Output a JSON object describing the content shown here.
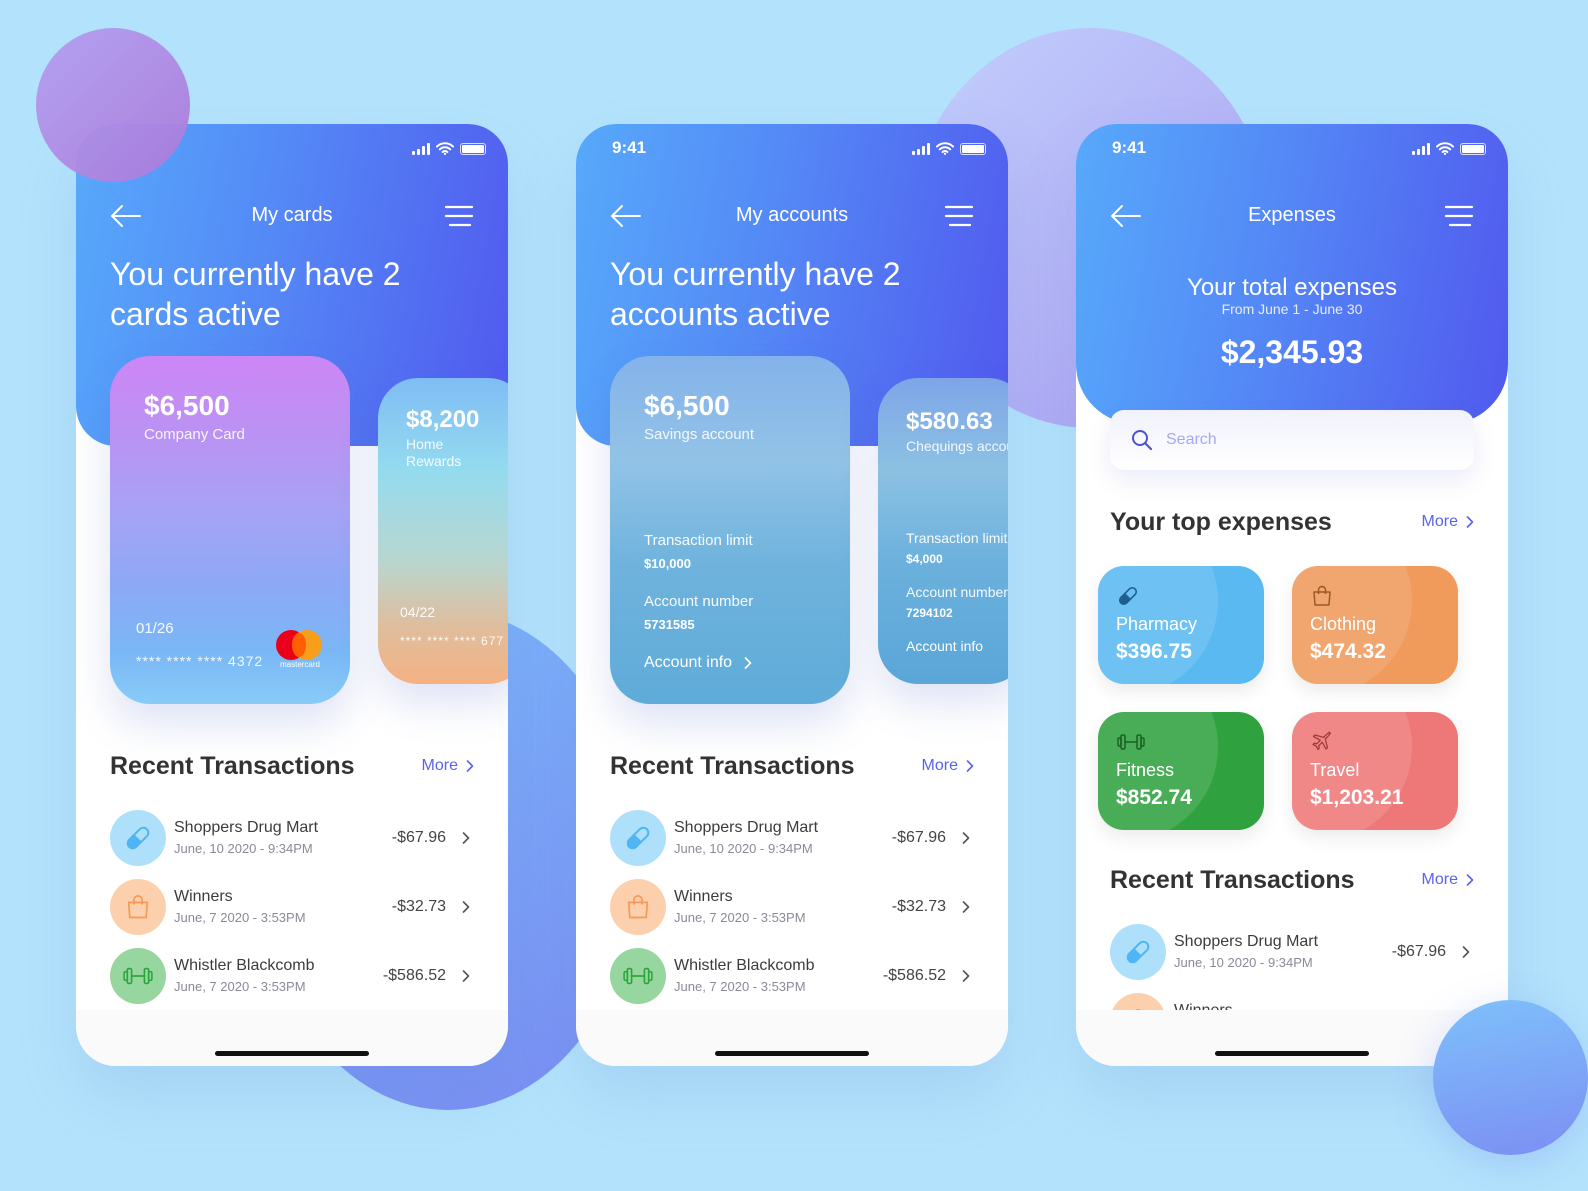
{
  "colors": {
    "background": "#b3e3fc",
    "header_gradient_start": "#57a9fb",
    "header_gradient_end": "#5159ee",
    "accent_link": "#5a63ec",
    "pharmacy": "#5bb9f2",
    "clothing": "#f09a5c",
    "fitness": "#2fa23f",
    "travel": "#ee7878"
  },
  "status_bar": {
    "time": "9:41"
  },
  "phone_cards": {
    "title": "My cards",
    "headline": "You currently have 2 cards active",
    "cards": [
      {
        "amount": "$6,500",
        "name": "Company Card",
        "expiry": "01/26",
        "number": "**** **** **** 4372",
        "brand": "mastercard"
      },
      {
        "amount": "$8,200",
        "name_line1": "Home",
        "name_line2": "Rewards",
        "expiry": "04/22",
        "number": "**** **** **** 677"
      }
    ]
  },
  "phone_accounts": {
    "title": "My accounts",
    "headline": "You currently have 2 accounts active",
    "accounts": [
      {
        "amount": "$6,500",
        "name": "Savings account",
        "limit_label": "Transaction limit",
        "limit": "$10,000",
        "number_label": "Account number",
        "number": "5731585",
        "info_label": "Account info"
      },
      {
        "amount": "$580.63",
        "name": "Chequings account",
        "limit_label": "Transaction limit",
        "limit": "$4,000",
        "number_label": "Account number",
        "number": "7294102",
        "info_label": "Account info"
      }
    ]
  },
  "phone_expenses": {
    "title": "Expenses",
    "total_label": "Your total expenses",
    "range": "From June 1 - June 30",
    "total": "$2,345.93",
    "search_placeholder": "Search",
    "top_expenses_heading": "Your top expenses",
    "categories": [
      {
        "name": "Pharmacy",
        "amount": "$396.75",
        "icon": "pill-icon"
      },
      {
        "name": "Clothing",
        "amount": "$474.32",
        "icon": "shopping-bag-icon"
      },
      {
        "name": "Fitness",
        "amount": "$852.74",
        "icon": "dumbbell-icon"
      },
      {
        "name": "Travel",
        "amount": "$1,203.21",
        "icon": "airplane-icon"
      }
    ]
  },
  "transactions_section": {
    "heading": "Recent Transactions",
    "more_label": "More"
  },
  "transactions": [
    {
      "merchant": "Shoppers Drug Mart",
      "date": "June, 10 2020 - 9:34PM",
      "amount": "-$67.96",
      "icon": "pill-icon"
    },
    {
      "merchant": "Winners",
      "date": "June, 7 2020 - 3:53PM",
      "amount": "-$32.73",
      "icon": "shopping-bag-icon"
    },
    {
      "merchant": "Whistler Blackcomb",
      "date": "June, 7 2020 - 3:53PM",
      "amount": "-$586.52",
      "icon": "dumbbell-icon"
    }
  ]
}
